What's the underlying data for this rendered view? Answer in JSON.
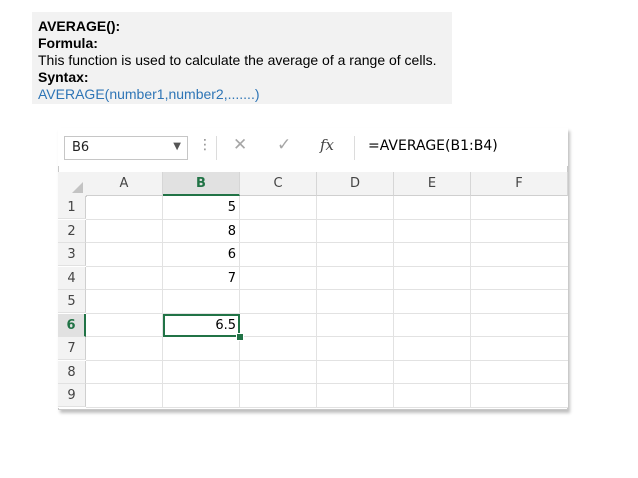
{
  "info": {
    "heading": "AVERAGE():",
    "formula_label": "Formula:",
    "description": "This function is used to calculate the average of a range of cells.",
    "syntax_label": "Syntax:",
    "syntax": "AVERAGE(number1,number2,.......)"
  },
  "formula_bar": {
    "name_box": "B6",
    "fx": "fx",
    "formula": "=AVERAGE(B1:B4)"
  },
  "sheet": {
    "columns": [
      "A",
      "B",
      "C",
      "D",
      "E",
      "F"
    ],
    "rows": [
      "1",
      "2",
      "3",
      "4",
      "5",
      "6",
      "7",
      "8",
      "9"
    ],
    "b_values": [
      "5",
      "8",
      "6",
      "7",
      "",
      "6.5",
      "",
      "",
      ""
    ],
    "selected_column": "B",
    "selected_row": "6"
  },
  "colors": {
    "accent": "#217346",
    "link": "#2e75b6"
  }
}
